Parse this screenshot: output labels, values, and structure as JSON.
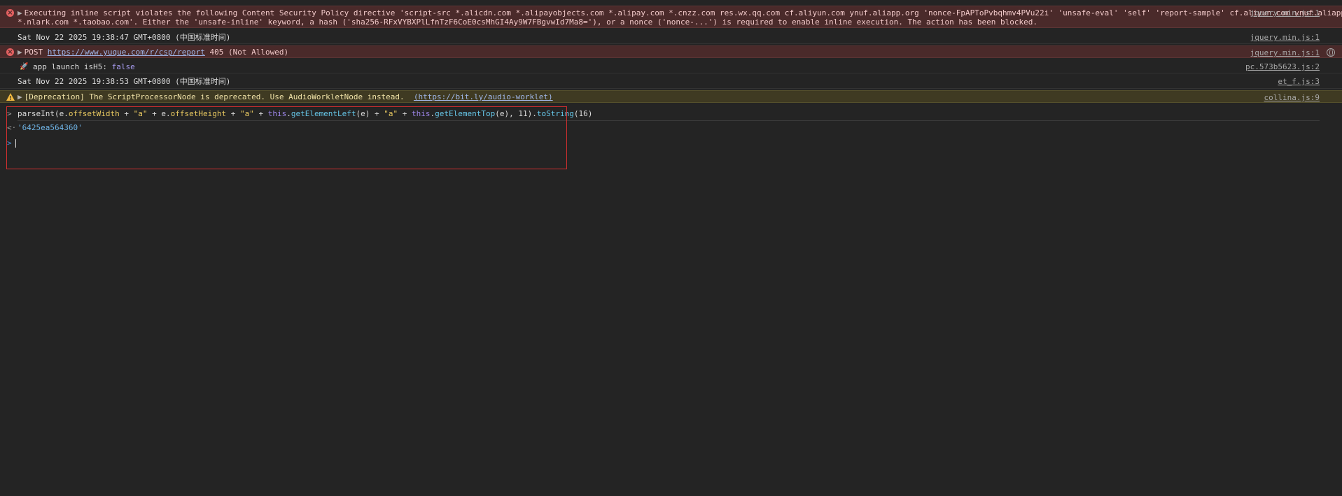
{
  "messages": {
    "csp_error": {
      "line1": "Executing inline script violates the following Content Security Policy directive 'script-src *.alicdn.com *.alipayobjects.com *.alipay.com *.cnzz.com res.wx.qq.com cf.aliyun.com ynuf.aliapp.org 'nonce-FpAPToPvbqhmv4PVu22i' 'unsafe-eval' 'self' 'report-sample' cf.aliyun.com ynuf.aliapp.org",
      "line2": "*.nlark.com *.taobao.com'. Either the 'unsafe-inline' keyword, a hash ('sha256-RFxVYBXPlLfnTzF6CoE0csMhGI4Ay9W7FBgvwId7Ma8='), or a nonce ('nonce-...') is required to enable inline execution. The action has been blocked.",
      "source": "jquery.min.js:1"
    },
    "timestamp1": {
      "text": "Sat Nov 22 2025 19:38:47 GMT+0800 (中国标准时间)",
      "source": "jquery.min.js:1"
    },
    "post_error": {
      "method": "POST",
      "url": "https://www.yuque.com/r/csp/report",
      "status": "405 (Not Allowed)",
      "source": "jquery.min.js:1"
    },
    "launch_log": {
      "text": "app launch isH5:",
      "value": "false",
      "source": "pc.573b5623.js:2"
    },
    "timestamp2": {
      "text": "Sat Nov 22 2025 19:38:53 GMT+0800 (中国标准时间)",
      "source": "et_f.js:3"
    },
    "deprecation": {
      "prefix": "[Deprecation] The ScriptProcessorNode is deprecated. Use AudioWorkletNode instead.",
      "url": "(https://bit.ly/audio-worklet)",
      "source": "collina.js:9"
    }
  },
  "input": {
    "fn": "parseInt",
    "arg1": "e",
    "prop1": "offsetWidth",
    "sep": "\"a\"",
    "prop2": "offsetHeight",
    "kw_this": "this",
    "m1": "getElementLeft",
    "m2": "getElementTop",
    "radix": "11",
    "m3": "toString",
    "base": "16"
  },
  "result": "'6425ea564360'",
  "icons": {
    "error": "error-circle-icon",
    "warning": "warning-triangle-icon",
    "rocket": "rocket-icon",
    "globe": "globe-icon"
  }
}
